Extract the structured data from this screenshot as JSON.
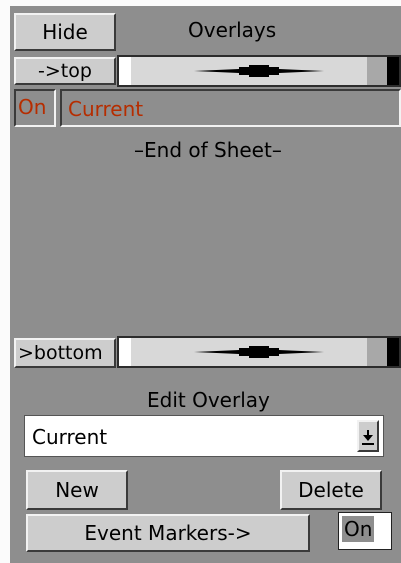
{
  "header": {
    "hide_label": "Hide",
    "title": "Overlays"
  },
  "overlay_list": {
    "to_top_label": "->top",
    "to_bottom_label": ">bottom",
    "items": [
      {
        "state": "On",
        "name": "Current"
      }
    ],
    "end_text": "–End of Sheet–"
  },
  "edit": {
    "heading": "Edit Overlay",
    "selected_overlay": "Current",
    "dropdown_arrow": "down-arrow-icon",
    "new_label": "New",
    "delete_label": "Delete",
    "event_markers_label": "Event Markers->",
    "event_markers_state": "On"
  },
  "colors": {
    "panel": "#8e8e8e",
    "button": "#cdcdcd",
    "active_text": "#b62d00"
  }
}
